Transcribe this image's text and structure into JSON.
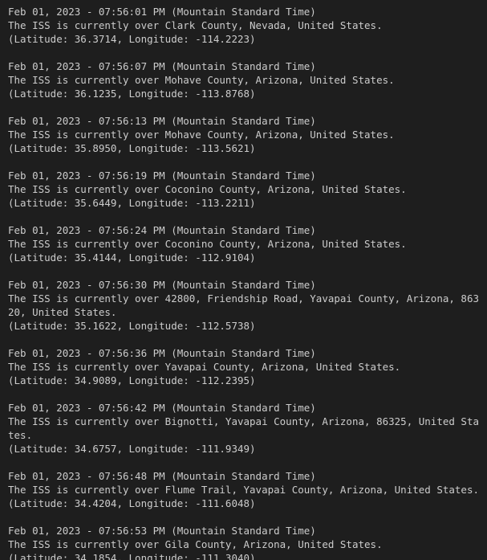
{
  "terminal": {
    "entries": [
      {
        "timestamp": "Feb 01, 2023 - 07:56:01 PM (Mountain Standard Time)",
        "location": "The ISS is currently over Clark County, Nevada, United States.",
        "coords": "(Latitude: 36.3714, Longitude: -114.2223)"
      },
      {
        "timestamp": "Feb 01, 2023 - 07:56:07 PM (Mountain Standard Time)",
        "location": "The ISS is currently over Mohave County, Arizona, United States.",
        "coords": "(Latitude: 36.1235, Longitude: -113.8768)"
      },
      {
        "timestamp": "Feb 01, 2023 - 07:56:13 PM (Mountain Standard Time)",
        "location": "The ISS is currently over Mohave County, Arizona, United States.",
        "coords": "(Latitude: 35.8950, Longitude: -113.5621)"
      },
      {
        "timestamp": "Feb 01, 2023 - 07:56:19 PM (Mountain Standard Time)",
        "location": "The ISS is currently over Coconino County, Arizona, United States.",
        "coords": "(Latitude: 35.6449, Longitude: -113.2211)"
      },
      {
        "timestamp": "Feb 01, 2023 - 07:56:24 PM (Mountain Standard Time)",
        "location": "The ISS is currently over Coconino County, Arizona, United States.",
        "coords": "(Latitude: 35.4144, Longitude: -112.9104)"
      },
      {
        "timestamp": "Feb 01, 2023 - 07:56:30 PM (Mountain Standard Time)",
        "location": "The ISS is currently over 42800, Friendship Road, Yavapai County, Arizona, 86320, United States.",
        "coords": "(Latitude: 35.1622, Longitude: -112.5738)"
      },
      {
        "timestamp": "Feb 01, 2023 - 07:56:36 PM (Mountain Standard Time)",
        "location": "The ISS is currently over Yavapai County, Arizona, United States.",
        "coords": "(Latitude: 34.9089, Longitude: -112.2395)"
      },
      {
        "timestamp": "Feb 01, 2023 - 07:56:42 PM (Mountain Standard Time)",
        "location": "The ISS is currently over Bignotti, Yavapai County, Arizona, 86325, United States.",
        "coords": "(Latitude: 34.6757, Longitude: -111.9349)"
      },
      {
        "timestamp": "Feb 01, 2023 - 07:56:48 PM (Mountain Standard Time)",
        "location": "The ISS is currently over Flume Trail, Yavapai County, Arizona, United States.",
        "coords": "(Latitude: 34.4204, Longitude: -111.6048)"
      },
      {
        "timestamp": "Feb 01, 2023 - 07:56:53 PM (Mountain Standard Time)",
        "location": "The ISS is currently over Gila County, Arizona, United States.",
        "coords": "(Latitude: 34.1854, Longitude: -111.3040)"
      }
    ]
  }
}
